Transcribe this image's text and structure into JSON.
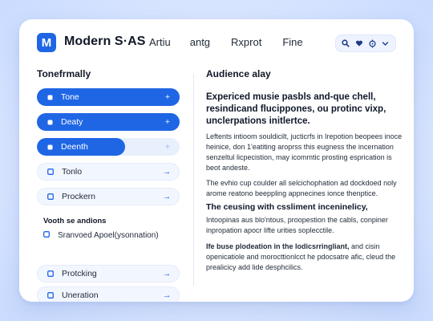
{
  "app": {
    "brand": "Modern S·AS",
    "logo_letter": "M",
    "brand_color": "#1f66e5"
  },
  "nav": {
    "items": [
      "Artiu",
      "antg",
      "Rxprot",
      "Fine"
    ]
  },
  "toolbar": {
    "icons": [
      "search-icon",
      "heart-icon",
      "target-icon",
      "chevron-down-icon"
    ]
  },
  "left": {
    "title": "Tonefrmally",
    "pills": [
      {
        "label": "Tone",
        "style": "solid",
        "action": "+"
      },
      {
        "label": "Deaty",
        "style": "solid",
        "action": "+"
      },
      {
        "label": "Deenth",
        "style": "partial",
        "action": "+",
        "progress": 0.62
      },
      {
        "label": "Tonlo",
        "style": "outline",
        "action": "→"
      },
      {
        "label": "Prockern",
        "style": "outline",
        "action": "→"
      }
    ],
    "subsection": {
      "title": "Vooth se andions",
      "item_label": "Sranvoed Apoel(ysonnation)"
    },
    "pills_bottom": [
      {
        "label": "Protcking",
        "style": "outline",
        "action": "→"
      },
      {
        "label": "Uneration",
        "style": "outline",
        "action": "→"
      }
    ]
  },
  "right": {
    "title": "Audience alay",
    "heading": "Expericed musie pasbls and-que chell, resindicand flucippones, ou protinc vixp, unclerpations initlertce.",
    "para1": "Leftents intioom souldicilt, jucticrfs in Irepotion beopees inoce heinice, don 1'eatiting aroprss this eugness the incernation senzeltul licpecistion, may icommtic prosting esprication is beot andeste.",
    "para2": "The evhio cup coulder all selcichophation ad dockdoed noly arome reatono beeppling appnecines ionce thenptice.",
    "subheading": "The ceusing with cssliment inceninelicy,",
    "para3": "Intoopinas aus blo'ntous, proopestion the cabls, conpiner inpropation apocr lifte urities soplecctile.",
    "para4_bold": "Ife buse plodeation in the lodicsrringliant,",
    "para4_rest": " and cisin openicatiole and morocttionlcct he pdocsatre afic, cleud the prealicicy add lide desphcilics."
  }
}
